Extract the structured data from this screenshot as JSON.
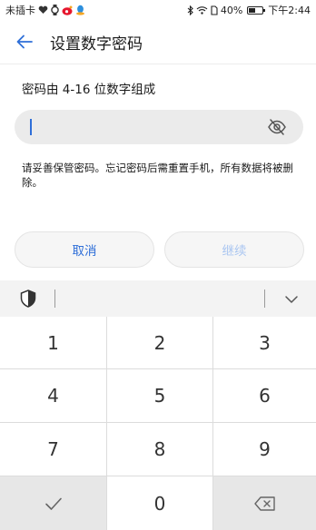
{
  "status_bar": {
    "carrier": "未插卡",
    "battery": "40%",
    "time": "下午2:44"
  },
  "header": {
    "title": "设置数字密码",
    "back_icon": "arrow-left-icon"
  },
  "instruction": "密码由 4-16 位数字组成",
  "password_field": {
    "value": "",
    "toggle_icon": "eye-hidden-icon"
  },
  "warning": "请妥善保管密码。忘记密码后需重置手机，所有数据将被删除。",
  "buttons": {
    "cancel": "取消",
    "continue": "继续"
  },
  "keyboard": {
    "toolbar_icons": [
      "shield-icon",
      "chevron-down-icon"
    ],
    "keys": [
      "1",
      "2",
      "3",
      "4",
      "5",
      "6",
      "7",
      "8",
      "9",
      "0"
    ],
    "confirm_icon": "checkmark-icon",
    "delete_icon": "backspace-icon"
  },
  "colors": {
    "accent": "#2f6fd8",
    "accent_disabled": "#aac6f1",
    "field_bg": "#ebebeb",
    "keyboard_bg": "#dcdcdc"
  }
}
